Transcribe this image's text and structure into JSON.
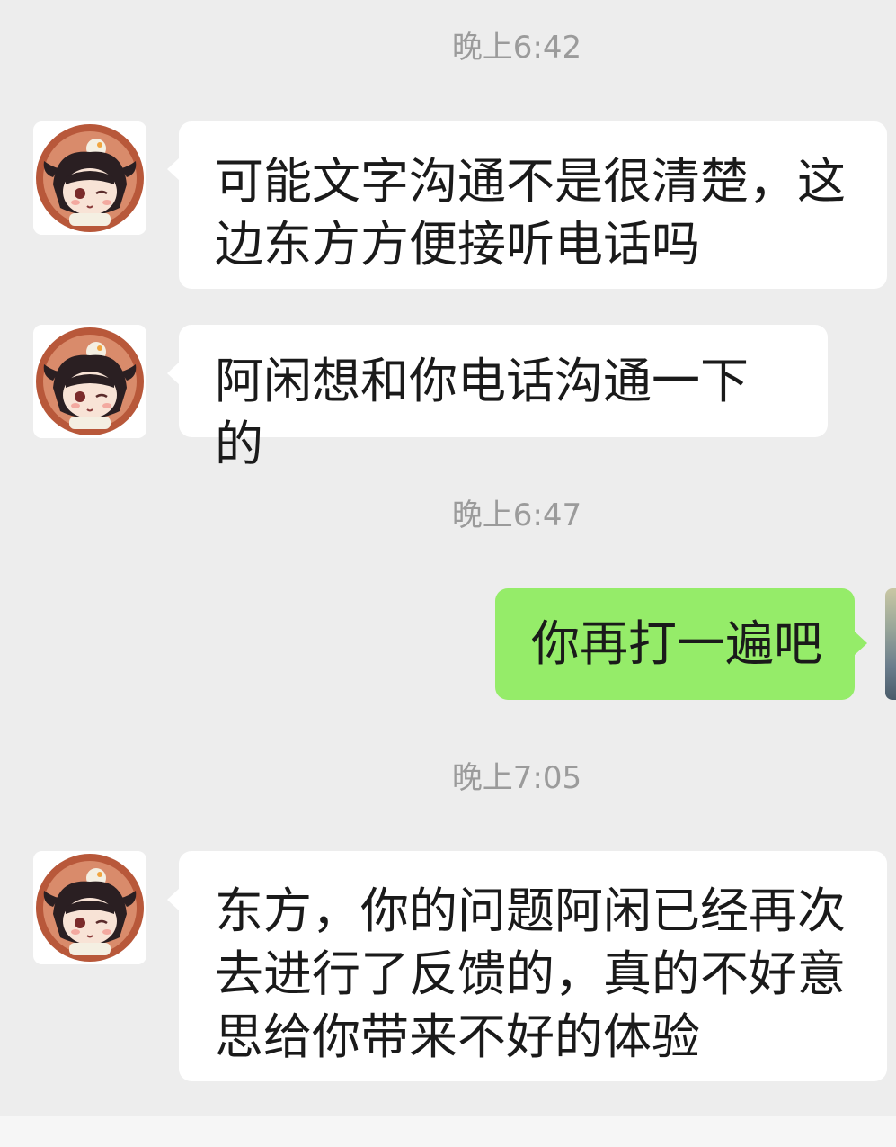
{
  "messages": [
    {
      "type": "time",
      "text": "晚上6:42"
    },
    {
      "type": "incoming",
      "avatar": "anime-girl-avatar",
      "text": "可能文字沟通不是很清楚，这边东方方便接听电话吗"
    },
    {
      "type": "incoming",
      "avatar": "anime-girl-avatar",
      "text": "阿闲想和你电话沟通一下的"
    },
    {
      "type": "time",
      "text": "晚上6:47"
    },
    {
      "type": "outgoing",
      "text": "你再打一遍吧"
    },
    {
      "type": "time",
      "text": "晚上7:05"
    },
    {
      "type": "incoming",
      "avatar": "anime-girl-avatar",
      "text": "东方，你的问题阿闲已经再次去进行了反馈的，真的不好意思给你带来不好的体验"
    }
  ],
  "colors": {
    "background": "#ededed",
    "incoming_bubble": "#ffffff",
    "outgoing_bubble": "#95ec69",
    "timestamp": "#9b9b9b",
    "text": "#1a1a1a"
  }
}
